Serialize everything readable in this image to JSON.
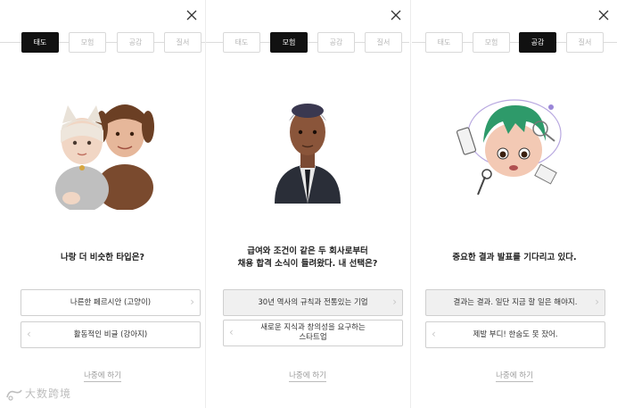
{
  "steps": [
    "태도",
    "모험",
    "공감",
    "질서"
  ],
  "panels": [
    {
      "active_step": 0,
      "question": [
        "나랑 더 비슷한 타입은?"
      ],
      "options": [
        "나른한 페르시안 (고양이)",
        "활동적인 비글 (강아지)"
      ],
      "later": "나중에 하기"
    },
    {
      "active_step": 1,
      "question": [
        "급여와 조건이 같은 두 회사로부터",
        "채용 합격 소식이 들려왔다. 내 선택은?"
      ],
      "options": [
        "30년 역사의 규칙과 전통있는 기업",
        "새로운 지식과 창의성을 요구하는",
        "스타트업"
      ],
      "later": "나중에 하기"
    },
    {
      "active_step": 2,
      "question": [
        "중요한 결과 발표를 기다리고 있다."
      ],
      "options": [
        "결과는 결과. 일단 지금 할 일은 해야지.",
        "제발 부디! 한숨도 못 잤어."
      ],
      "later": "나중에 하기"
    }
  ],
  "watermark": "大数跨境",
  "icons": {
    "close": "close-icon",
    "next": "chevron-right-icon",
    "prev": "chevron-left-icon"
  }
}
